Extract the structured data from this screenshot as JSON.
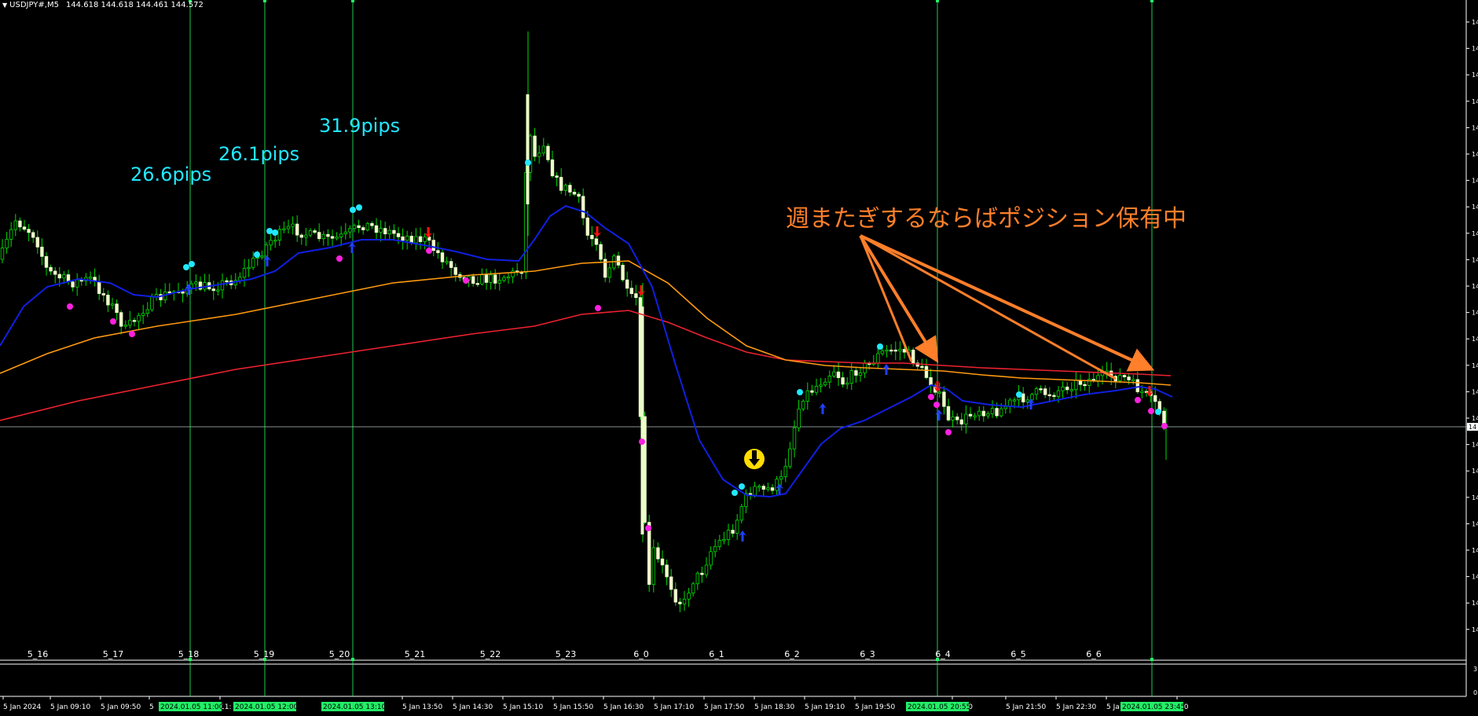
{
  "header": {
    "symbol": "USDJPY#,M5",
    "quotes": "144.618 144.618 144.461 144.572"
  },
  "colors": {
    "background": "#000000",
    "candle_up_body": "#ecffc8",
    "candle_wick": "#00dd00",
    "vline": "#22ff66",
    "hline": "#9fb0b0",
    "ma_blue": "#1020e0",
    "ma_orange": "#ff9a10",
    "ma_red": "#ee2230",
    "pips_text": "#22e8ff",
    "annotation_text": "#ff7f2a",
    "arrow_color": "#ff7f2a",
    "dot_cyan": "#22e8ff",
    "dot_magenta": "#ff20e0",
    "signal_red": "#ff1010",
    "signal_blue": "#2040ff",
    "signal_yellow": "#ffdd00",
    "axis_line": "#ffffff",
    "axis_text": "#ffffff",
    "date_highlight_bg": "#22ee66",
    "date_highlight_text": "#000000"
  },
  "pips_labels": [
    "26.6pips",
    "26.1pips",
    "31.9pips"
  ],
  "annotation": "週またぎするならばポジション保有中",
  "separator_labels": [
    "5_16",
    "5_17",
    "5_18",
    "5_19",
    "5_20",
    "5_21",
    "5_22",
    "5_23",
    "6_0",
    "6_1",
    "6_2",
    "6_3",
    "6_4",
    "6_5",
    "6_6"
  ],
  "time_axis_labels": [
    "5 Jan 2024",
    "5 Jan 09:10",
    "5 Jan 09:50",
    "5",
    "11:",
    "5 Jan 13:50",
    "5 Jan 14:30",
    "5 Jan 15:10",
    "5 Jan 15:50",
    "5 Jan 16:30",
    "5 Jan 17:10",
    "5 Jan 17:50",
    "5 Jan 18:30",
    "5 Jan 19:10",
    "5 Jan 19:50",
    "21:10",
    "5 Jan 21:50",
    "5 Jan 22:30",
    "5 Ja",
    ":50"
  ],
  "highlighted_times": [
    "2024.01.05 11:00",
    "2024.01.05 12:00",
    "2024.01.05 13:10",
    "2024.01.05 20:55",
    "2024.01.05 23:45"
  ],
  "price_axis_labels": [
    "14",
    "14",
    "14",
    "14",
    "14",
    "14",
    "14",
    "14",
    "14",
    "14",
    "14",
    "14",
    "14",
    "14",
    "14",
    "14",
    "14",
    "14",
    "14",
    "14",
    "14",
    "14",
    "14",
    "14"
  ],
  "current_price_tag": "14",
  "subwindow_labels": [
    "3",
    "0"
  ]
}
